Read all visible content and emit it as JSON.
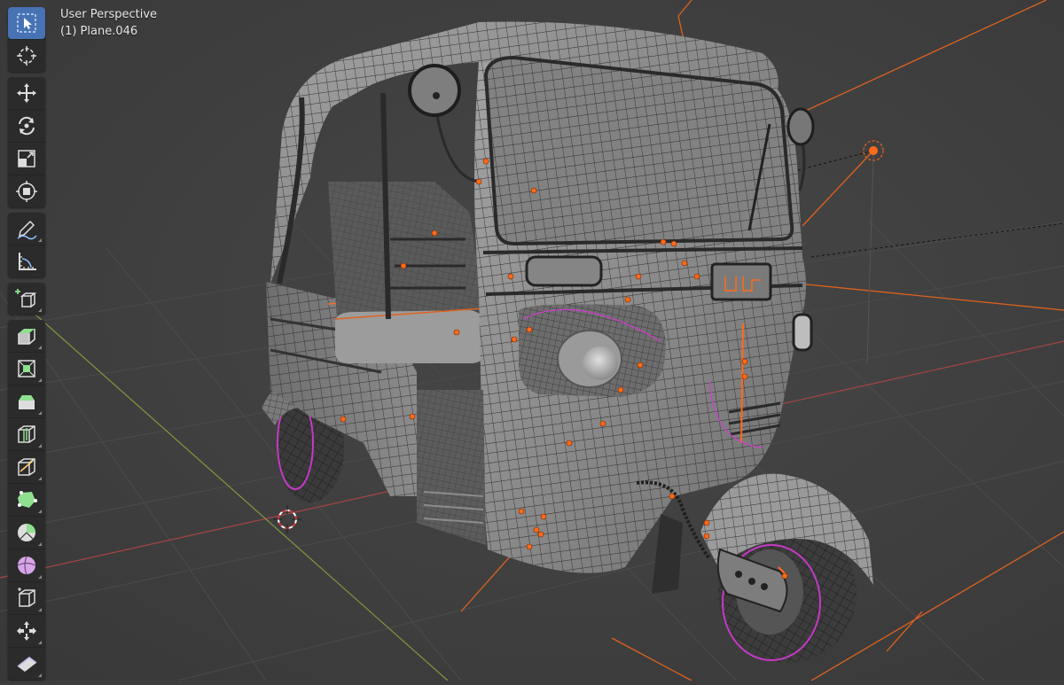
{
  "viewport": {
    "title": "User Perspective",
    "object": "(1) Plane.046"
  },
  "toolbar": {
    "groups": [
      [
        {
          "name": "select-box",
          "icon": "select-box-icon",
          "active": true
        },
        {
          "name": "cursor",
          "icon": "cursor-icon"
        }
      ],
      [
        {
          "name": "move",
          "icon": "move-icon"
        },
        {
          "name": "rotate",
          "icon": "rotate-icon"
        },
        {
          "name": "scale",
          "icon": "scale-icon"
        },
        {
          "name": "transform",
          "icon": "transform-icon"
        }
      ],
      [
        {
          "name": "annotate",
          "icon": "annotate-icon"
        },
        {
          "name": "measure",
          "icon": "measure-icon"
        }
      ],
      [
        {
          "name": "add-cube",
          "icon": "add-cube-icon"
        }
      ],
      [
        {
          "name": "extrude",
          "icon": "extrude-icon"
        },
        {
          "name": "inset",
          "icon": "inset-icon"
        },
        {
          "name": "bevel",
          "icon": "bevel-icon"
        },
        {
          "name": "loop-cut",
          "icon": "loop-cut-icon"
        },
        {
          "name": "knife",
          "icon": "knife-icon"
        },
        {
          "name": "poly-build",
          "icon": "poly-build-icon"
        },
        {
          "name": "spin",
          "icon": "spin-icon"
        },
        {
          "name": "smooth",
          "icon": "smooth-icon"
        },
        {
          "name": "edge-slide",
          "icon": "edge-slide-icon"
        },
        {
          "name": "shrink-fatten",
          "icon": "shrink-fatten-icon"
        },
        {
          "name": "shear",
          "icon": "shear-icon"
        }
      ]
    ]
  },
  "colors": {
    "accent": "#4772b3",
    "selection": "#ff6a1a",
    "axis_x": "#b34a4a",
    "axis_y": "#7b9a3a",
    "grid": "#4a4a4a",
    "seam": "#d23cd2",
    "mesh_body": "#8e8e8e",
    "wire": "#2a2a2a"
  }
}
